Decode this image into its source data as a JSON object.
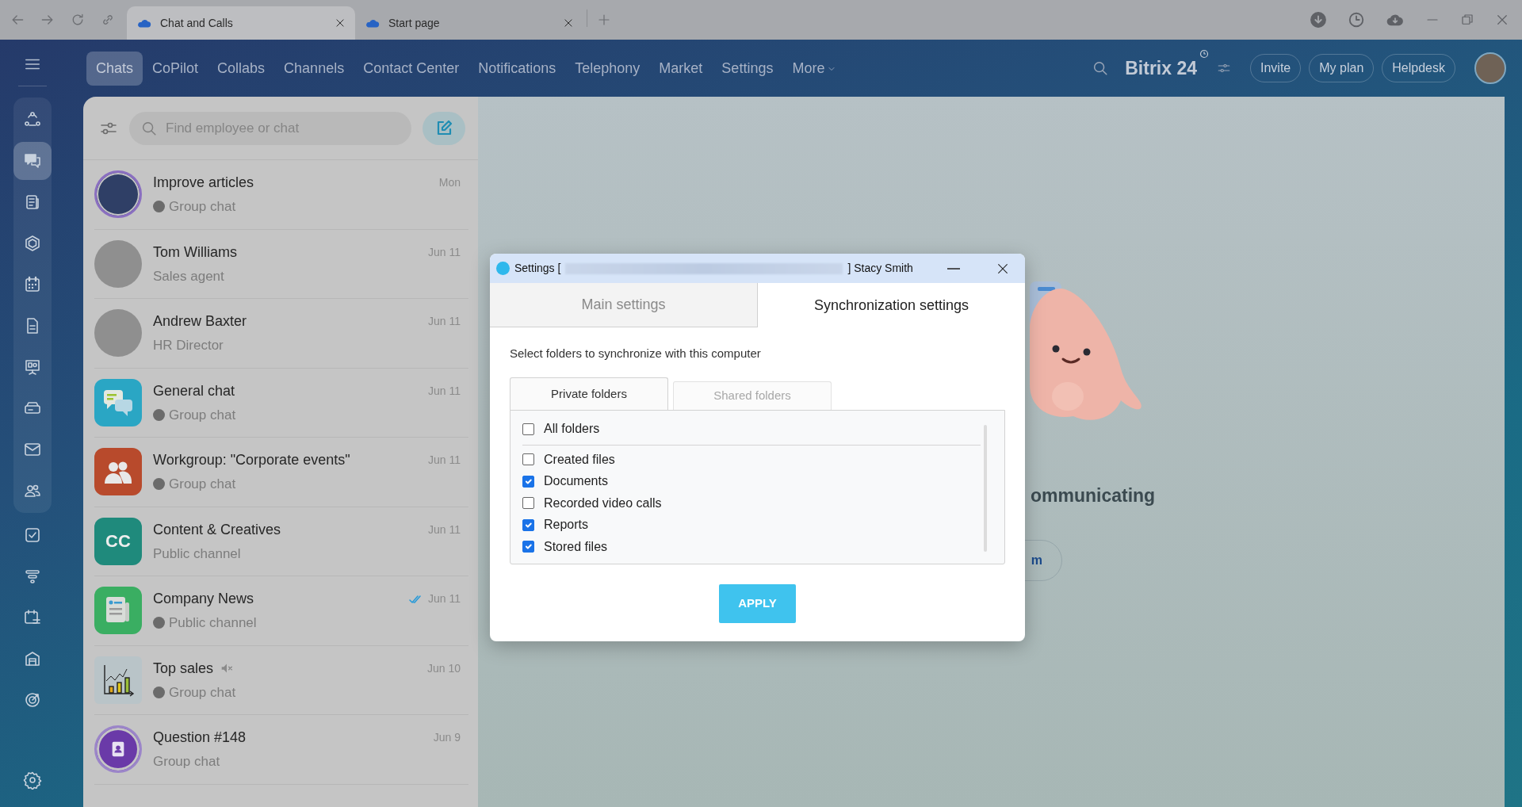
{
  "browser": {
    "tabs": [
      {
        "title": "Chat and Calls",
        "selected": true
      },
      {
        "title": "Start page",
        "selected": false
      }
    ]
  },
  "rail": {
    "items": [
      {
        "kind": "network",
        "selected": false
      },
      {
        "kind": "chat",
        "selected": true
      },
      {
        "kind": "feed",
        "selected": false
      },
      {
        "kind": "hexagon",
        "selected": false
      },
      {
        "kind": "calendar",
        "selected": false
      },
      {
        "kind": "document",
        "selected": false
      },
      {
        "kind": "board",
        "selected": false
      },
      {
        "kind": "drive",
        "selected": false
      },
      {
        "kind": "mail",
        "selected": false
      },
      {
        "kind": "people",
        "selected": false
      },
      {
        "kind": "task",
        "selected": false
      },
      {
        "kind": "funnel",
        "selected": false
      },
      {
        "kind": "schedule",
        "selected": false
      },
      {
        "kind": "store",
        "selected": false
      },
      {
        "kind": "target",
        "selected": false
      },
      {
        "kind": "settings",
        "selected": false
      }
    ]
  },
  "nav": {
    "items": [
      {
        "label": "Chats",
        "selected": true,
        "kind": "link"
      },
      {
        "label": "CoPilot",
        "selected": false,
        "kind": "link"
      },
      {
        "label": "Collabs",
        "selected": false,
        "kind": "link"
      },
      {
        "label": "Channels",
        "selected": false,
        "kind": "link"
      },
      {
        "label": "Contact Center",
        "selected": false,
        "kind": "link"
      },
      {
        "label": "Notifications",
        "selected": false,
        "kind": "link"
      },
      {
        "label": "Telephony",
        "selected": false,
        "kind": "link"
      },
      {
        "label": "Market",
        "selected": false,
        "kind": "link"
      },
      {
        "label": "Settings",
        "selected": false,
        "kind": "link"
      },
      {
        "label": "More",
        "selected": false,
        "kind": "menu"
      }
    ]
  },
  "header": {
    "logo": "Bitrix",
    "logo_number": "24",
    "buttons": [
      "Invite",
      "My plan",
      "Helpdesk"
    ]
  },
  "chat_panel": {
    "search": {
      "placeholder": "Find employee or chat"
    },
    "chats": [
      {
        "name": "Improve articles",
        "subtitle": "Group chat",
        "time": "Mon",
        "kind": "photo-ring",
        "color": "#8a6fc0",
        "sub_avatar": true,
        "muted": false,
        "read": false
      },
      {
        "name": "Tom Williams",
        "subtitle": "Sales agent",
        "time": "Jun 11",
        "kind": "photo",
        "color": "#8f8f8f",
        "sub_avatar": false,
        "muted": false,
        "read": false
      },
      {
        "name": "Andrew Baxter",
        "subtitle": "HR Director",
        "time": "Jun 11",
        "kind": "photo",
        "color": "#8f8f8f",
        "sub_avatar": false,
        "muted": false,
        "read": false
      },
      {
        "name": "General chat",
        "subtitle": "Group chat",
        "time": "Jun 11",
        "kind": "bubbles",
        "color": "#2aa6c4",
        "sub_avatar": true,
        "muted": false,
        "read": false
      },
      {
        "name": "Workgroup: \"Corporate events\"",
        "subtitle": "Group chat",
        "time": "Jun 11",
        "kind": "people",
        "color": "#b84a2c",
        "sub_avatar": true,
        "muted": false,
        "read": false
      },
      {
        "name": "Content & Creatives",
        "subtitle": "Public channel",
        "time": "Jun 11",
        "kind": "initials",
        "initials": "CC",
        "color": "#1f8a7c",
        "sub_avatar": false,
        "muted": false,
        "read": false
      },
      {
        "name": "Company News",
        "subtitle": "Public channel",
        "time": "Jun 11",
        "kind": "newspaper",
        "color": "#3aae62",
        "sub_avatar": true,
        "muted": false,
        "read": true
      },
      {
        "name": "Top sales",
        "subtitle": "Group chat",
        "time": "Jun 10",
        "kind": "chart",
        "color": "#b9c4c8",
        "sub_avatar": true,
        "muted": true,
        "read": false
      },
      {
        "name": "Question #148",
        "subtitle": "Group chat",
        "time": "Jun 9",
        "kind": "contact",
        "color": "#6a3aa8",
        "sub_avatar": false,
        "muted": false,
        "read": false
      }
    ]
  },
  "background": {
    "heading": "ommunicating",
    "button": "m"
  },
  "dialog": {
    "title_prefix": "Settings [",
    "title_suffix": "] Stacy Smith",
    "tabs": [
      {
        "label": "Main settings",
        "selected": false
      },
      {
        "label": "Synchronization settings",
        "selected": true
      }
    ],
    "instruction": "Select folders to synchronize with this computer",
    "folder_tabs": [
      {
        "label": "Private folders",
        "selected": true
      },
      {
        "label": "Shared folders",
        "selected": false
      }
    ],
    "all_folders": {
      "label": "All folders",
      "checked": false
    },
    "folders": [
      {
        "label": "Created files",
        "checked": false
      },
      {
        "label": "Documents",
        "checked": true
      },
      {
        "label": "Recorded video calls",
        "checked": false
      },
      {
        "label": "Reports",
        "checked": true
      },
      {
        "label": "Stored files",
        "checked": true
      }
    ],
    "apply": "APPLY"
  }
}
